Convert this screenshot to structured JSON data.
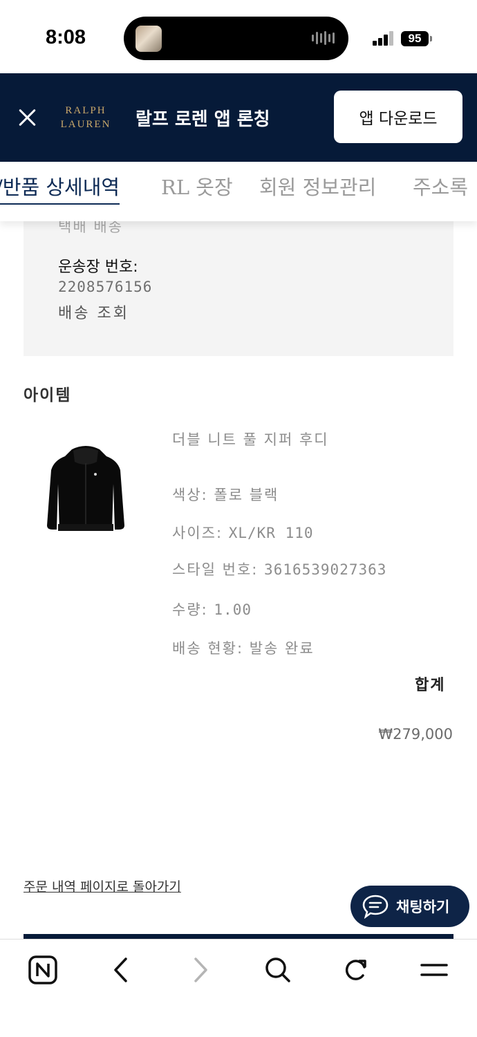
{
  "status_bar": {
    "time": "8:08",
    "battery": "95"
  },
  "app_banner": {
    "logo_line1": "RALPH",
    "logo_line2": "LAUREN",
    "title": "랄프 로렌 앱 론칭",
    "download_label": "앱 다운로드"
  },
  "tabs": [
    {
      "label": "/반품 상세내역",
      "active": true
    },
    {
      "label": "RL 옷장",
      "active": false
    },
    {
      "label": "회원 정보관리",
      "active": false
    },
    {
      "label": "주소록",
      "active": false
    }
  ],
  "shipping": {
    "method": "택배 배송",
    "tracking_label": "운송장 번호:",
    "tracking_number": "2208576156",
    "tracking_link": "배송 조회"
  },
  "items": {
    "heading": "아이템",
    "product": {
      "name": "더블 니트 풀 지퍼 후디",
      "color_label": "색상:",
      "color_value": "폴로 블랙",
      "size_label": "사이즈:",
      "size_value": "XL/KR 110",
      "style_label": "스타일 번호:",
      "style_value": "3616539027363",
      "qty_label": "수량:",
      "qty_value": "1.00",
      "status_label": "배송 현황:",
      "status_value": "발송 완료"
    },
    "total_label": "합계",
    "total_value": "₩279,000"
  },
  "back_link": "주문 내역 페이지로 돌아가기",
  "chat_label": "채팅하기",
  "colors": {
    "navy": "#061a38",
    "gold": "#c9a86a"
  },
  "browser_bar": {
    "icons": [
      "naver-n-icon",
      "back-icon",
      "forward-icon",
      "search-icon",
      "refresh-icon",
      "menu-icon"
    ]
  }
}
